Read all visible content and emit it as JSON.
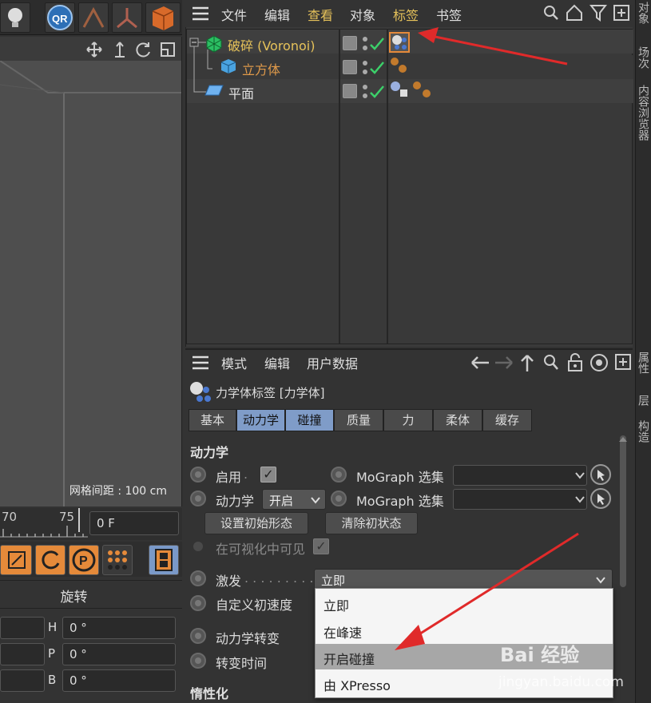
{
  "left": {
    "grid_label": "网格间距 : 100 cm",
    "timeline_ticks": [
      "70",
      "75"
    ],
    "frame_value": "0 F",
    "rotation_header": "旋转",
    "coords": [
      {
        "axis": "H",
        "value": "0 °"
      },
      {
        "axis": "P",
        "value": "0 °"
      },
      {
        "axis": "B",
        "value": "0 °"
      }
    ]
  },
  "object_manager": {
    "menu": [
      "文件",
      "编辑",
      "查看",
      "对象",
      "标签",
      "书签"
    ],
    "highlighted_menus": [
      "查看",
      "标签"
    ],
    "objects": [
      {
        "name": "破碎 (Voronoi)",
        "color": "#e6c25a",
        "icon": "voronoi-fracture-icon"
      },
      {
        "name": "立方体",
        "color": "#e09a4a",
        "icon": "cube-icon"
      },
      {
        "name": "平面",
        "color": "#e0e0e0",
        "icon": "plane-icon"
      }
    ]
  },
  "side_tabs": {
    "top": [
      "对象",
      "场次",
      "内容浏览器"
    ],
    "bottom": [
      "属性",
      "层",
      "构造"
    ]
  },
  "attributes": {
    "menu": [
      "模式",
      "编辑",
      "用户数据"
    ],
    "title": "力学体标签 [力学体]",
    "tabs": [
      "基本",
      "动力学",
      "碰撞",
      "质量",
      "力",
      "柔体",
      "缓存"
    ],
    "active_tabs": [
      "动力学",
      "碰撞"
    ],
    "section_dynamics": "动力学",
    "enable_label": "启用",
    "dynamics_label": "动力学",
    "dynamics_value": "开启",
    "mograph_label_1": "MoGraph 选集",
    "mograph_label_2": "MoGraph 选集",
    "set_initial_btn": "设置初始形态",
    "clear_initial_btn": "清除初状态",
    "visible_label": "在可视化中可见",
    "trigger_label": "激发",
    "trigger_value": "立即",
    "custom_velocity_label": "自定义初速度",
    "dynamics_transition_label": "动力学转变",
    "transition_time_label": "转变时间",
    "section_inertia": "惰性化"
  },
  "dropdown": {
    "options": [
      "立即",
      "在峰速",
      "开启碰撞",
      "由 XPresso"
    ],
    "highlighted": "开启碰撞"
  },
  "watermark": {
    "brand": "Bai 经验",
    "url": "jingyan.baidu.com"
  },
  "colors": {
    "accent": "#e6c25a",
    "tab_active": "#7f9cc8",
    "arrow": "#e02a2a"
  }
}
